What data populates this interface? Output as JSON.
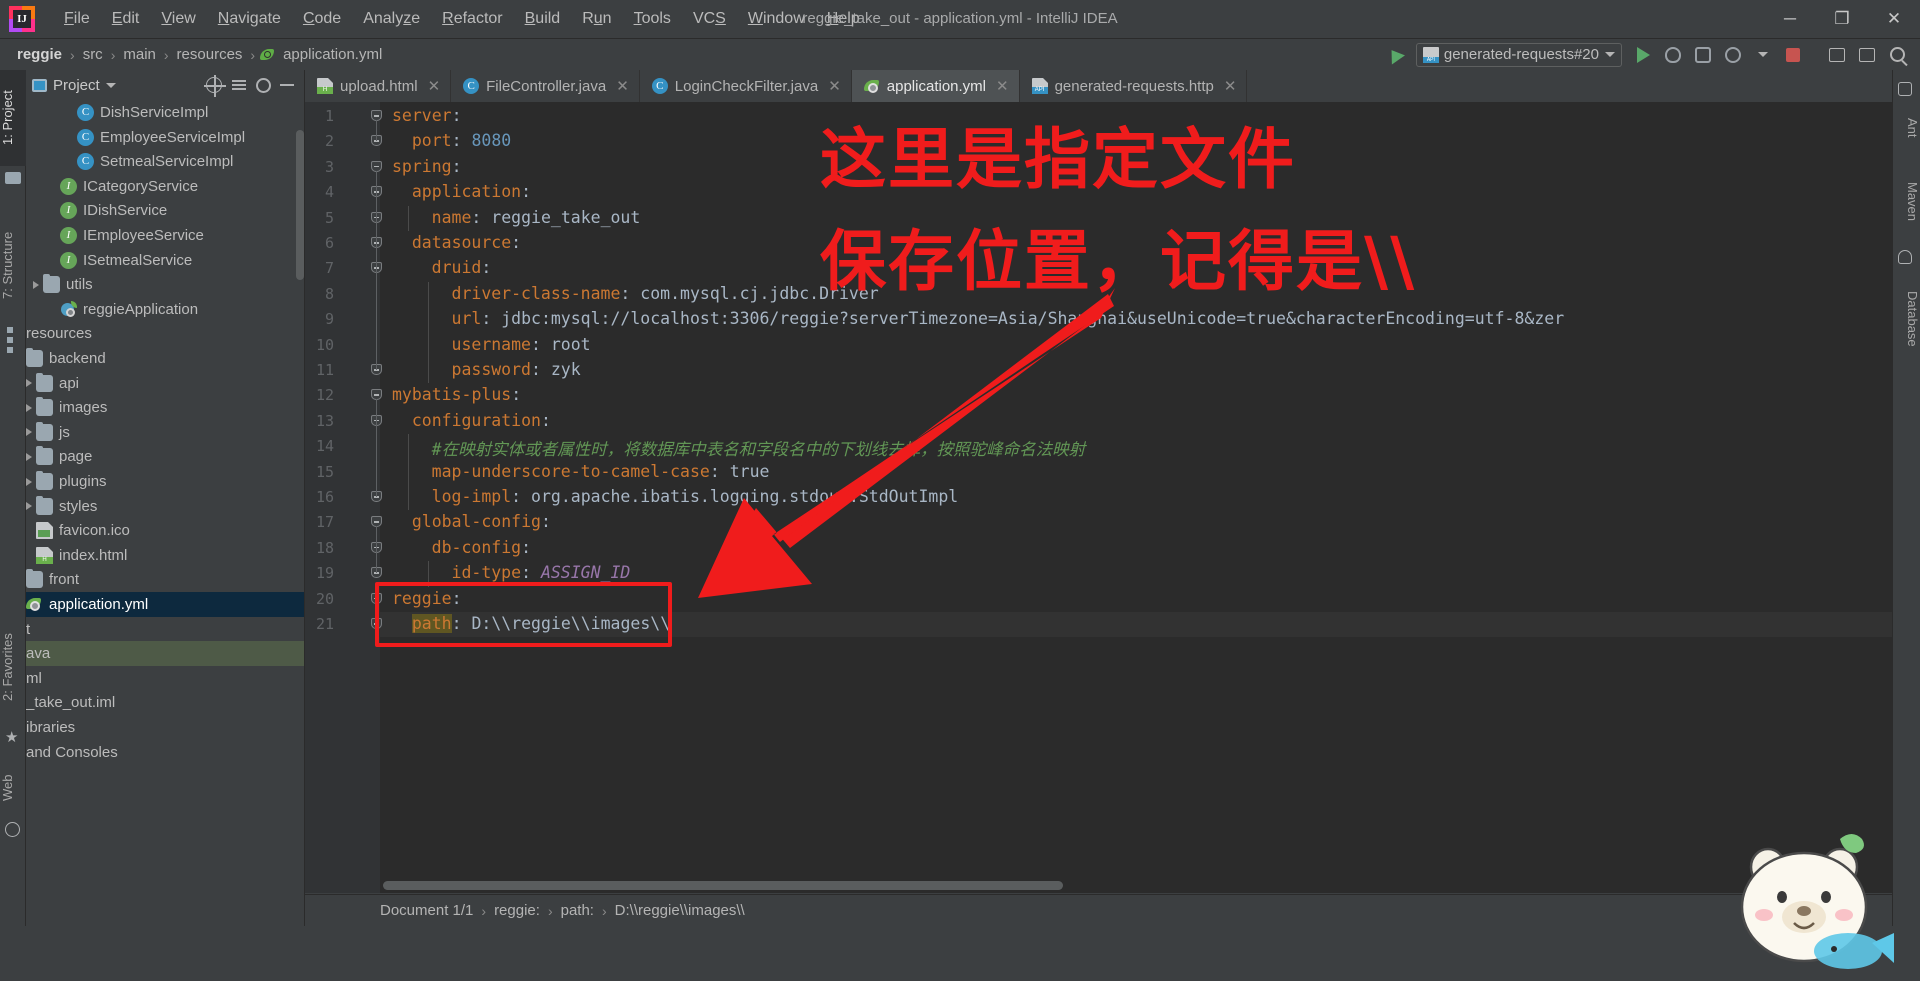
{
  "window": {
    "title": "reggie_take_out - application.yml - IntelliJ IDEA",
    "minimize": "─",
    "maximize": "❐",
    "close": "✕",
    "logo_letters": "IJ"
  },
  "menubar": [
    {
      "label": "File",
      "mnemonic": "F"
    },
    {
      "label": "Edit",
      "mnemonic": "E"
    },
    {
      "label": "View",
      "mnemonic": "V"
    },
    {
      "label": "Navigate",
      "mnemonic": "N"
    },
    {
      "label": "Code",
      "mnemonic": "C"
    },
    {
      "label": "Analyze",
      "mnemonic": "z"
    },
    {
      "label": "Refactor",
      "mnemonic": "R"
    },
    {
      "label": "Build",
      "mnemonic": "B"
    },
    {
      "label": "Run",
      "mnemonic": "u"
    },
    {
      "label": "Tools",
      "mnemonic": "T"
    },
    {
      "label": "VCS",
      "mnemonic": "S"
    },
    {
      "label": "Window",
      "mnemonic": "W"
    },
    {
      "label": "Help",
      "mnemonic": "H"
    }
  ],
  "navbar": {
    "breadcrumbs": [
      "reggie",
      "src",
      "main",
      "resources",
      "application.yml"
    ],
    "separator": "›",
    "run_config": "generated-requests#20",
    "run_config_caret": "▼"
  },
  "left_strip": {
    "project_tab": "1: Project",
    "structure_tab": "7: Structure",
    "favorites_tab": "2: Favorites",
    "web_tab": "Web"
  },
  "right_strip": {
    "ant_tab": "Ant",
    "maven_tab": "Maven",
    "database_tab": "Database"
  },
  "project_panel": {
    "title": "Project",
    "caret": "▼",
    "tree": [
      {
        "label": "DishServiceImpl",
        "icon": "class-icon",
        "indent": 5,
        "arrow": false,
        "clipped": true
      },
      {
        "label": "EmployeeServiceImpl",
        "icon": "class-icon",
        "indent": 5,
        "arrow": false
      },
      {
        "label": "SetmealServiceImpl",
        "icon": "class-icon",
        "indent": 5,
        "arrow": false
      },
      {
        "label": "ICategoryService",
        "icon": "interface-icon",
        "indent": 4,
        "arrow": false
      },
      {
        "label": "IDishService",
        "icon": "interface-icon",
        "indent": 4,
        "arrow": false
      },
      {
        "label": "IEmployeeService",
        "icon": "interface-icon",
        "indent": 4,
        "arrow": false
      },
      {
        "label": "ISetmealService",
        "icon": "interface-icon",
        "indent": 4,
        "arrow": false
      },
      {
        "label": "utils",
        "icon": "folder-icon",
        "indent": 3,
        "arrow": true
      },
      {
        "label": "reggieApplication",
        "icon": "spring-boot-icon",
        "indent": 4,
        "arrow": false
      },
      {
        "label": "resources",
        "icon": "none",
        "indent": 1,
        "arrow": false
      },
      {
        "label": "backend",
        "icon": "folder-icon",
        "indent": 1,
        "arrow": false
      },
      {
        "label": "api",
        "icon": "folder-icon",
        "indent": 2,
        "arrow": true
      },
      {
        "label": "images",
        "icon": "folder-icon",
        "indent": 2,
        "arrow": true
      },
      {
        "label": "js",
        "icon": "folder-icon",
        "indent": 2,
        "arrow": true
      },
      {
        "label": "page",
        "icon": "folder-icon",
        "indent": 2,
        "arrow": true
      },
      {
        "label": "plugins",
        "icon": "folder-icon",
        "indent": 2,
        "arrow": true
      },
      {
        "label": "styles",
        "icon": "folder-icon",
        "indent": 2,
        "arrow": true
      },
      {
        "label": "favicon.ico",
        "icon": "image-file-icon",
        "indent": 2,
        "arrow": false
      },
      {
        "label": "index.html",
        "icon": "html-file-icon",
        "indent": 2,
        "arrow": false
      },
      {
        "label": "front",
        "icon": "folder-icon",
        "indent": 1,
        "arrow": false
      },
      {
        "label": "application.yml",
        "icon": "yml-icon",
        "indent": 1,
        "arrow": false,
        "selected": true
      },
      {
        "label": "t",
        "icon": "none",
        "indent": 1,
        "arrow": false,
        "clipped": true
      },
      {
        "label": "ava",
        "icon": "none",
        "indent": 1,
        "arrow": false,
        "clipped": true,
        "green": true
      },
      {
        "label": "ml",
        "icon": "none",
        "indent": 1,
        "arrow": false,
        "clipped": true
      },
      {
        "label": "_take_out.iml",
        "icon": "none",
        "indent": 1,
        "arrow": false,
        "clipped": true
      },
      {
        "label": "ibraries",
        "icon": "none",
        "indent": 1,
        "arrow": false,
        "clipped": true
      },
      {
        "label": "and Consoles",
        "icon": "none",
        "indent": 1,
        "arrow": false,
        "clipped": true
      }
    ]
  },
  "editor_tabs": [
    {
      "label": "upload.html",
      "icon": "html-file-icon",
      "active": false,
      "close": "✕"
    },
    {
      "label": "FileController.java",
      "icon": "class-icon",
      "active": false,
      "close": "✕"
    },
    {
      "label": "LoginCheckFilter.java",
      "icon": "class-icon",
      "active": false,
      "close": "✕"
    },
    {
      "label": "application.yml",
      "icon": "yml-icon",
      "active": true,
      "close": "✕"
    },
    {
      "label": "generated-requests.http",
      "icon": "http-file-icon",
      "active": false,
      "close": "✕"
    }
  ],
  "code": {
    "lines": [
      {
        "n": 1,
        "indent": 0,
        "fold": "start",
        "text": "server:",
        "type": "key"
      },
      {
        "n": 2,
        "indent": 1,
        "fold": "end",
        "text": "port: 8080",
        "type": "key-num"
      },
      {
        "n": 3,
        "indent": 0,
        "fold": "start",
        "text": "spring:",
        "type": "key"
      },
      {
        "n": 4,
        "indent": 1,
        "fold": "start",
        "text": "application:",
        "type": "key"
      },
      {
        "n": 5,
        "indent": 2,
        "fold": "end",
        "text": "name: reggie_take_out",
        "type": "key-val"
      },
      {
        "n": 6,
        "indent": 1,
        "fold": "start",
        "text": "datasource:",
        "type": "key"
      },
      {
        "n": 7,
        "indent": 2,
        "fold": "start",
        "text": "druid:",
        "type": "key"
      },
      {
        "n": 8,
        "indent": 3,
        "fold": "none",
        "text": "driver-class-name: com.mysql.cj.jdbc.Driver",
        "type": "key-val"
      },
      {
        "n": 9,
        "indent": 3,
        "fold": "none",
        "text": "url: jdbc:mysql://localhost:3306/reggie?serverTimezone=Asia/Shanghai&useUnicode=true&characterEncoding=utf-8&zer",
        "type": "key-val"
      },
      {
        "n": 10,
        "indent": 3,
        "fold": "none",
        "text": "username: root",
        "type": "key-val"
      },
      {
        "n": 11,
        "indent": 3,
        "fold": "end",
        "text": "password: zyk",
        "type": "key-val"
      },
      {
        "n": 12,
        "indent": 0,
        "fold": "start",
        "text": "mybatis-plus:",
        "type": "key"
      },
      {
        "n": 13,
        "indent": 1,
        "fold": "start",
        "text": "configuration:",
        "type": "key"
      },
      {
        "n": 14,
        "indent": 2,
        "fold": "none",
        "text": "#在映射实体或者属性时，将数据库中表名和字段名中的下划线去掉，按照驼峰命名法映射",
        "type": "comment"
      },
      {
        "n": 15,
        "indent": 2,
        "fold": "none",
        "text": "map-underscore-to-camel-case: true",
        "type": "key-val"
      },
      {
        "n": 16,
        "indent": 2,
        "fold": "end",
        "text": "log-impl: org.apache.ibatis.logging.stdout.StdOutImpl",
        "type": "key-val"
      },
      {
        "n": 17,
        "indent": 1,
        "fold": "start",
        "text": "global-config:",
        "type": "key"
      },
      {
        "n": 18,
        "indent": 2,
        "fold": "start",
        "text": "db-config:",
        "type": "key"
      },
      {
        "n": 19,
        "indent": 3,
        "fold": "end",
        "text": "id-type: ASSIGN_ID",
        "type": "key-const"
      },
      {
        "n": 20,
        "indent": 0,
        "fold": "start",
        "text": "reggie:",
        "type": "key"
      },
      {
        "n": 21,
        "indent": 1,
        "fold": "end",
        "text": "path: D:\\\\reggie\\\\images\\\\",
        "type": "key-val-hl"
      }
    ]
  },
  "bottom_breadcrumb": {
    "document": "Document 1/1",
    "items": [
      "reggie:",
      "path:",
      "D:\\\\reggie\\\\images\\\\"
    ],
    "separator": "›"
  },
  "annotation": {
    "line1": "这里是指定文件",
    "line2": "保存位置，记得是\\\\",
    "color": "#f01c1c",
    "box_label": "reggie-path-highlight-box",
    "arrow_label": "red-arrow-pointer"
  }
}
